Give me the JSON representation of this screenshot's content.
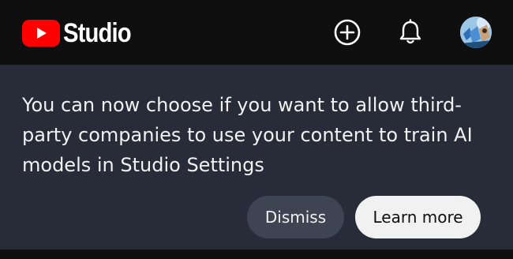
{
  "app": {
    "name": "Studio",
    "logo_icon": "youtube-play-logo",
    "brand_color": "#ff0000"
  },
  "header": {
    "create_icon": "plus-circle-icon",
    "notifications_icon": "bell-icon",
    "avatar_icon": "avatar"
  },
  "banner": {
    "message": "You can now choose if you want to allow third-party companies to use your content to train AI models in Studio Settings",
    "dismiss_label": "Dismiss",
    "learn_more_label": "Learn more",
    "background": "#272c38"
  }
}
